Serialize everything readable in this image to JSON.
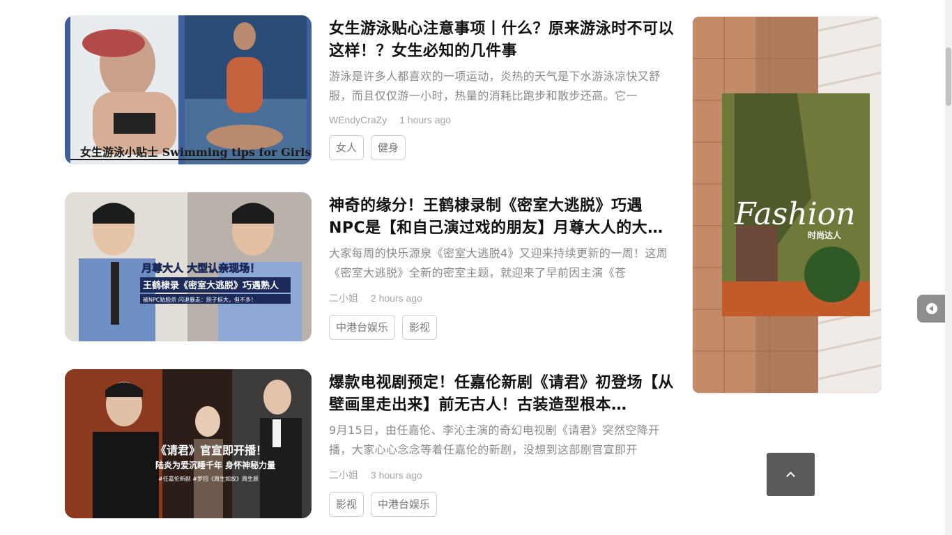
{
  "articles": [
    {
      "title": "女生游泳贴心注意事项丨什么？原来游泳时不可以这样！？女生必知的几件事",
      "excerpt": "游泳是许多人都喜欢的一项运动，炎热的天气是下水游泳凉快又舒服，而且仅仅游一小时，热量的消耗比跑步和散步还高。它一",
      "author": "WEndyCraZy",
      "time": "1 hours ago",
      "tags": [
        "女人",
        "健身"
      ],
      "thumb_caption": "女生游泳小贴士 Swimming tips for Girls"
    },
    {
      "title": "神奇的缘分！王鹤棣录制《密室大逃脱》巧遇NPC是【和自己演过戏的朋友】月尊大人的大…",
      "excerpt": "大家每周的快乐源泉《密室大逃脱4》又迎来持续更新的一周！这周《密室大逃脱》全新的密室主题，就迎来了早前因主演《苍",
      "author": "二小姐",
      "time": "2 hours ago",
      "tags": [
        "中港台娱乐",
        "影视"
      ],
      "thumb_caption_1": "月尊大人 大型认亲现场！",
      "thumb_caption_2": "王鹤棣录《密室大逃脱》巧遇熟人",
      "thumb_caption_3": "被NPC贴脸杀 闪退暴走：胆子挺大，但不多！"
    },
    {
      "title": "爆款电视剧预定！任嘉伦新剧《请君》初登场【从壁画里走出来】前无古人！古装造型根本…",
      "excerpt": "9月15日，由任嘉伦、李沁主演的奇幻电视剧《请君》突然空降开播，大家心心念念等着任嘉伦的新剧，没想到这部剧官宣即开",
      "author": "二小姐",
      "time": "3 hours ago",
      "tags": [
        "影视",
        "中港台娱乐"
      ],
      "thumb_caption_1": "《请君》官宣即开播！",
      "thumb_caption_2": "陆炎为爱沉睡千年 身怀神秘力量",
      "thumb_caption_3": "#任嘉伦新剧 #梦回《周生如故》周生辰"
    }
  ],
  "ad": {
    "script_text": "Fashion",
    "sub_text": "时尚达人"
  },
  "icons": {
    "side_toggle": "play-left-icon",
    "back_to_top": "chevron-up-icon"
  },
  "colors": {
    "tag_border": "#cfcfcf",
    "meta": "#a5a5a5",
    "back_top_bg": "#5a5a5a"
  }
}
